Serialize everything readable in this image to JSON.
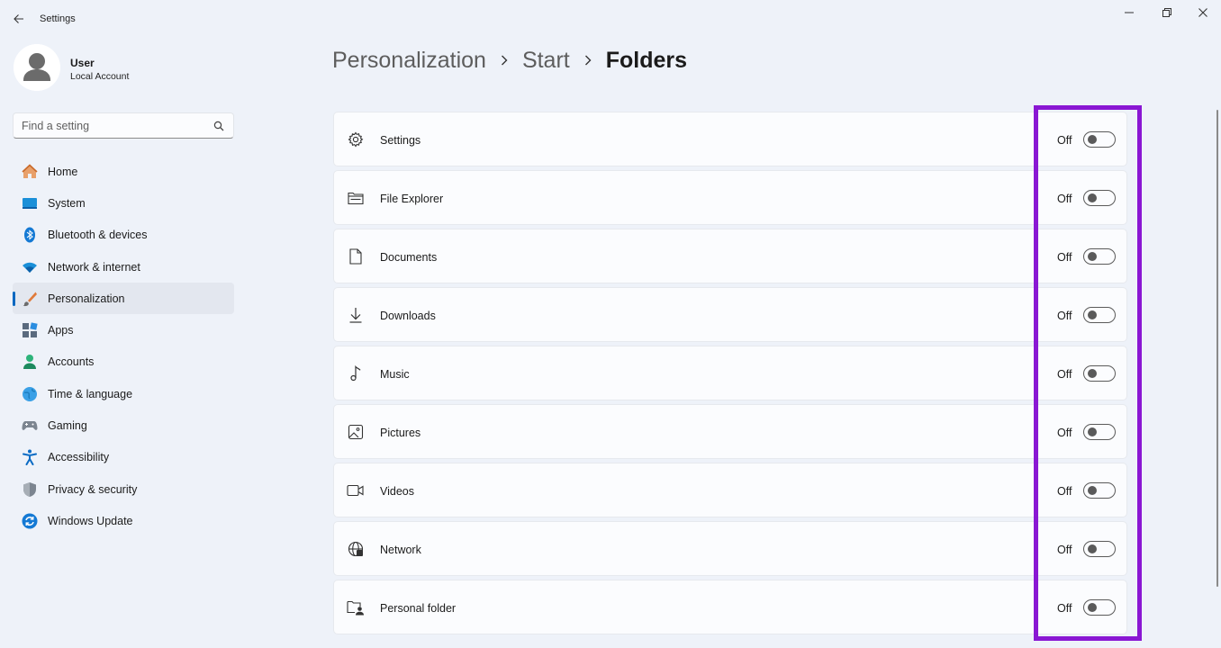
{
  "window": {
    "title": "Settings",
    "controls": {
      "minimize": "minimize-icon",
      "maximize": "restore-icon",
      "close": "close-icon"
    }
  },
  "profile": {
    "name": "User",
    "account_type": "Local Account"
  },
  "search": {
    "placeholder": "Find a setting"
  },
  "sidebar": {
    "items": [
      {
        "label": "Home",
        "icon": "home-icon"
      },
      {
        "label": "System",
        "icon": "system-icon"
      },
      {
        "label": "Bluetooth & devices",
        "icon": "bluetooth-icon"
      },
      {
        "label": "Network & internet",
        "icon": "wifi-icon"
      },
      {
        "label": "Personalization",
        "icon": "paintbrush-icon",
        "active": true
      },
      {
        "label": "Apps",
        "icon": "apps-icon"
      },
      {
        "label": "Accounts",
        "icon": "accounts-icon"
      },
      {
        "label": "Time & language",
        "icon": "globe-clock-icon"
      },
      {
        "label": "Gaming",
        "icon": "gamepad-icon"
      },
      {
        "label": "Accessibility",
        "icon": "accessibility-icon"
      },
      {
        "label": "Privacy & security",
        "icon": "shield-icon"
      },
      {
        "label": "Windows Update",
        "icon": "update-icon"
      }
    ]
  },
  "breadcrumb": {
    "items": [
      "Personalization",
      "Start",
      "Folders"
    ]
  },
  "folders": {
    "rows": [
      {
        "label": "Settings",
        "state": "Off",
        "icon": "gear-icon"
      },
      {
        "label": "File Explorer",
        "state": "Off",
        "icon": "file-explorer-icon"
      },
      {
        "label": "Documents",
        "state": "Off",
        "icon": "document-icon"
      },
      {
        "label": "Downloads",
        "state": "Off",
        "icon": "download-icon"
      },
      {
        "label": "Music",
        "state": "Off",
        "icon": "music-note-icon"
      },
      {
        "label": "Pictures",
        "state": "Off",
        "icon": "picture-icon"
      },
      {
        "label": "Videos",
        "state": "Off",
        "icon": "video-icon"
      },
      {
        "label": "Network",
        "state": "Off",
        "icon": "network-globe-icon"
      },
      {
        "label": "Personal folder",
        "state": "Off",
        "icon": "personal-folder-icon"
      }
    ]
  },
  "colors": {
    "accent": "#0067c0",
    "highlight_box": "#8a17d3",
    "background": "#eef2f9",
    "card": "#fbfcfe"
  }
}
